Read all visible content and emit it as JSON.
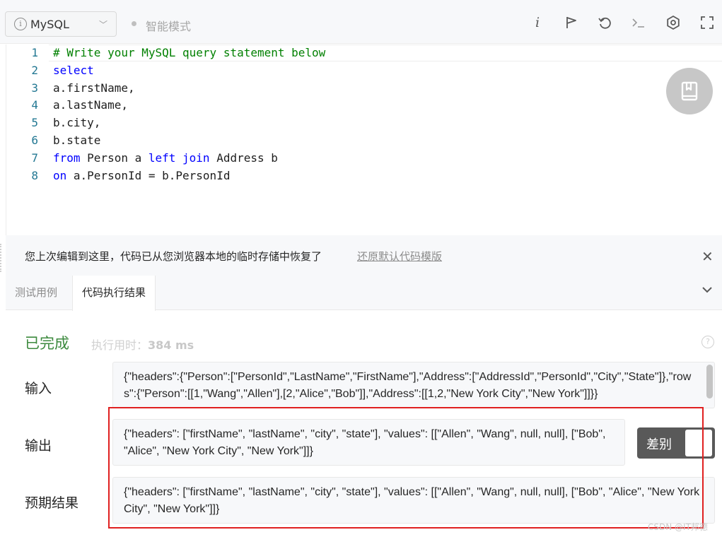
{
  "toolbar": {
    "language": "MySQL",
    "mode_label": "智能模式",
    "icons": [
      "info-icon",
      "run-icon",
      "reset-icon",
      "console-icon",
      "settings-icon",
      "fullscreen-icon"
    ]
  },
  "editor": {
    "lines": [
      {
        "n": "1",
        "tokens": [
          {
            "t": "# Write your MySQL query statement below",
            "c": "comment"
          }
        ]
      },
      {
        "n": "2",
        "tokens": [
          {
            "t": "select",
            "c": "kw"
          }
        ]
      },
      {
        "n": "3",
        "tokens": [
          {
            "t": "a.firstName,",
            "c": "plain"
          }
        ]
      },
      {
        "n": "4",
        "tokens": [
          {
            "t": "a.lastName,",
            "c": "plain"
          }
        ]
      },
      {
        "n": "5",
        "tokens": [
          {
            "t": "b.city,",
            "c": "plain"
          }
        ]
      },
      {
        "n": "6",
        "tokens": [
          {
            "t": "b.state",
            "c": "plain"
          }
        ]
      },
      {
        "n": "7",
        "tokens": [
          {
            "t": "from",
            "c": "kw"
          },
          {
            "t": " Person a ",
            "c": "plain"
          },
          {
            "t": "left",
            "c": "kw"
          },
          {
            "t": " ",
            "c": "plain"
          },
          {
            "t": "join",
            "c": "kw"
          },
          {
            "t": " Address b",
            "c": "plain"
          }
        ]
      },
      {
        "n": "8",
        "tokens": [
          {
            "t": "on",
            "c": "kw"
          },
          {
            "t": " a.PersonId = b.PersonId",
            "c": "plain"
          }
        ]
      }
    ]
  },
  "notice": {
    "text": "您上次编辑到这里，代码已从您浏览器本地的临时存储中恢复了",
    "link": "还原默认代码模版"
  },
  "tabs": [
    "测试用例",
    "代码执行结果"
  ],
  "result": {
    "status": "已完成",
    "exec_time_label": "执行用时：",
    "exec_time_value": "384 ms",
    "input_label": "输入",
    "input_value": "{\"headers\":{\"Person\":[\"PersonId\",\"LastName\",\"FirstName\"],\"Address\":[\"AddressId\",\"PersonId\",\"City\",\"State\"]},\"rows\":{\"Person\":[[1,\"Wang\",\"Allen\"],[2,\"Alice\",\"Bob\"]],\"Address\":[[1,2,\"New York City\",\"New York\"]]}}",
    "output_label": "输出",
    "output_value": "{\"headers\": [\"firstName\", \"lastName\", \"city\", \"state\"], \"values\": [[\"Allen\", \"Wang\", null, null], [\"Bob\", \"Alice\", \"New York City\", \"New York\"]]}",
    "expected_label": "预期结果",
    "expected_value": "{\"headers\": [\"firstName\", \"lastName\", \"city\", \"state\"], \"values\": [[\"Allen\", \"Wang\", null, null], [\"Bob\", \"Alice\", \"New York City\", \"New York\"]]}",
    "diff_label": "差别"
  },
  "watermark": "CSDN @IT邦德",
  "colors": {
    "status_done": "#3c8a3e",
    "keyword": "#0000ff",
    "comment": "#008000",
    "highlight": "#e02020"
  }
}
